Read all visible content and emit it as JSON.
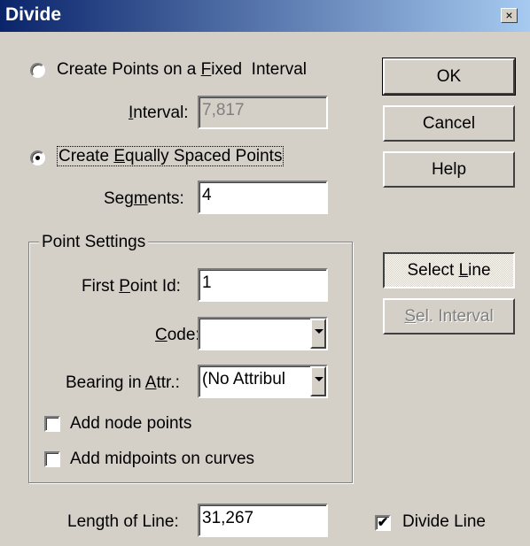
{
  "window": {
    "title": "Divide",
    "close_glyph": "×"
  },
  "mode": {
    "fixed_interval_label": "Create Points on a Fixed  Interval",
    "fixed_interval_selected": false,
    "interval_label": "Interval:",
    "interval_value": "7,817",
    "equal_spaced_label": "Create Equally Spaced Points",
    "equal_spaced_selected": true,
    "segments_label": "Segments:",
    "segments_value": "4"
  },
  "buttons": {
    "ok": "OK",
    "cancel": "Cancel",
    "help": "Help",
    "select_line": "Select Line",
    "sel_interval": "Sel. Interval"
  },
  "point_settings": {
    "group_label": "Point Settings",
    "first_point_label": "First Point Id:",
    "first_point_value": "1",
    "code_label": "Code:",
    "code_value": "",
    "bearing_label": "Bearing in Attr.:",
    "bearing_value": "(No Attribul",
    "add_node_points_label": "Add node points",
    "add_node_points_checked": false,
    "add_midpoints_label": "Add midpoints on curves",
    "add_midpoints_checked": false
  },
  "footer": {
    "length_label": "Length of Line:",
    "length_value": "31,267",
    "divide_line_label": "Divide Line",
    "divide_line_checked": true,
    "check_glyph": "✔"
  },
  "colors": {
    "face": "#d4d0c8",
    "title_start": "#0a246a",
    "title_end": "#a6caf0"
  }
}
